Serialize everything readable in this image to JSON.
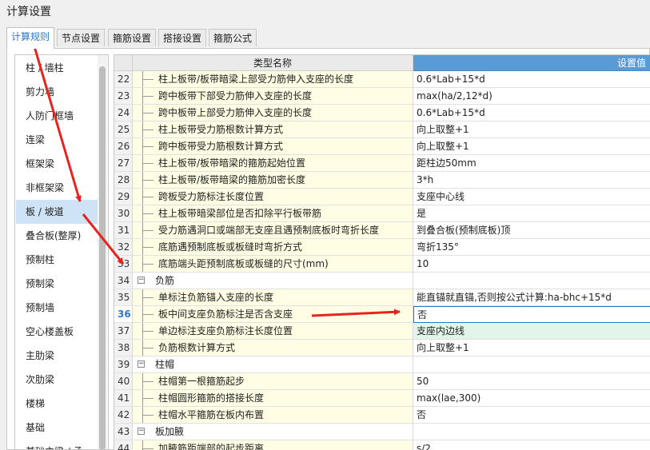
{
  "window": {
    "title": "计算设置"
  },
  "tabs": [
    {
      "label": "计算规则",
      "active": true
    },
    {
      "label": "节点设置",
      "active": false
    },
    {
      "label": "箍筋设置",
      "active": false
    },
    {
      "label": "搭接设置",
      "active": false
    },
    {
      "label": "箍筋公式",
      "active": false
    }
  ],
  "sidebar": {
    "items": [
      {
        "label": "柱 / 墙柱"
      },
      {
        "label": "剪力墙"
      },
      {
        "label": "人防门框墙"
      },
      {
        "label": "连梁"
      },
      {
        "label": "框架梁"
      },
      {
        "label": "非框架梁"
      },
      {
        "label": "板 / 坡道",
        "active": true
      },
      {
        "label": "叠合板(整厚)"
      },
      {
        "label": "预制柱"
      },
      {
        "label": "预制梁"
      },
      {
        "label": "预制墙"
      },
      {
        "label": "空心楼盖板"
      },
      {
        "label": "主肋梁"
      },
      {
        "label": "次肋梁"
      },
      {
        "label": "楼梯"
      },
      {
        "label": "基础"
      },
      {
        "label": "基础主梁 / 承"
      }
    ]
  },
  "table": {
    "columns": {
      "name": "类型名称",
      "value": "设置值"
    },
    "rows": [
      {
        "num": "22",
        "name": "柱上板带/板带暗梁上部受力筋伸入支座的长度",
        "value": "0.6*Lab+15*d",
        "type": "child"
      },
      {
        "num": "23",
        "name": "跨中板带下部受力筋伸入支座的长度",
        "value": "max(ha/2,12*d)",
        "type": "child"
      },
      {
        "num": "24",
        "name": "跨中板带上部受力筋伸入支座的长度",
        "value": "0.6*Lab+15*d",
        "type": "child"
      },
      {
        "num": "25",
        "name": "柱上板带受力筋根数计算方式",
        "value": "向上取整+1",
        "type": "child"
      },
      {
        "num": "26",
        "name": "跨中板带受力筋根数计算方式",
        "value": "向上取整+1",
        "type": "child"
      },
      {
        "num": "27",
        "name": "柱上板带/板带暗梁的箍筋起始位置",
        "value": "距柱边50mm",
        "type": "child"
      },
      {
        "num": "28",
        "name": "柱上板带/板带暗梁的箍筋加密长度",
        "value": "3*h",
        "type": "child"
      },
      {
        "num": "29",
        "name": "跨板受力筋标注长度位置",
        "value": "支座中心线",
        "type": "child"
      },
      {
        "num": "30",
        "name": "柱上板带暗梁部位是否扣除平行板带筋",
        "value": "是",
        "type": "child"
      },
      {
        "num": "31",
        "name": "受力筋遇洞口或端部无支座且遇预制底板时弯折长度",
        "value": "到叠合板(预制底板)顶",
        "type": "child"
      },
      {
        "num": "32",
        "name": "底筋遇预制底板或板缝时弯折方式",
        "value": "弯折135°",
        "type": "child"
      },
      {
        "num": "33",
        "name": "底筋端头距预制底板或板缝的尺寸(mm)",
        "value": "10",
        "type": "child"
      },
      {
        "num": "34",
        "name": "负筋",
        "value": "",
        "type": "group",
        "expander": "−"
      },
      {
        "num": "35",
        "name": "单标注负筋锚入支座的长度",
        "value": "能直锚就直锚,否则按公式计算:ha-bhc+15*d",
        "type": "child"
      },
      {
        "num": "36",
        "name": "板中间支座负筋标注是否含支座",
        "value": "否",
        "type": "child",
        "active": true
      },
      {
        "num": "37",
        "name": "单边标注支座负筋标注长度位置",
        "value": "支座内边线",
        "type": "child",
        "highlight": true
      },
      {
        "num": "38",
        "name": "负筋根数计算方式",
        "value": "向上取整+1",
        "type": "child"
      },
      {
        "num": "39",
        "name": "柱帽",
        "value": "",
        "type": "group",
        "expander": "−"
      },
      {
        "num": "40",
        "name": "柱帽第一根箍筋起步",
        "value": "50",
        "type": "child"
      },
      {
        "num": "41",
        "name": "柱帽圆形箍筋的搭接长度",
        "value": "max(lae,300)",
        "type": "child"
      },
      {
        "num": "42",
        "name": "柱帽水平箍筋在板内布置",
        "value": "否",
        "type": "child"
      },
      {
        "num": "43",
        "name": "板加腋",
        "value": "",
        "type": "group",
        "expander": "−"
      },
      {
        "num": "44",
        "name": "加腋筋距端部的起步距离",
        "value": "s/2",
        "type": "child"
      }
    ]
  },
  "colors": {
    "accent": "#2b78c5",
    "header_value_bg": "#5b9bd5",
    "child_row_bg": "#fffde3",
    "arrow": "#e8231d"
  }
}
